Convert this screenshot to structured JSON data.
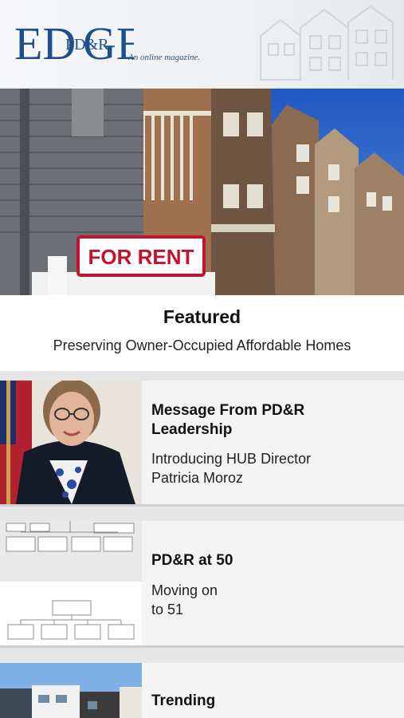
{
  "header": {
    "logo_letters_left": "ED",
    "logo_inner": "PD&R",
    "logo_letters_right": "GE",
    "tagline": "An online magazine."
  },
  "hero": {
    "sign_text": "FOR RENT"
  },
  "featured": {
    "title": "Featured",
    "subtitle": "Preserving Owner-Occupied Affordable Homes"
  },
  "cards": [
    {
      "title_line1": "Message From PD&R",
      "title_line2": "Leadership",
      "subtitle_line1": "Introducing HUB Director",
      "subtitle_line2": "Patricia Moroz"
    },
    {
      "title_line1": "PD&R at 50",
      "subtitle_line1": "Moving on",
      "subtitle_line2": "to 51"
    },
    {
      "title_line1": "Trending"
    }
  ],
  "colors": {
    "brand_blue": "#1f4e8c",
    "sign_red": "#c8102e",
    "sky": "#2f66c4"
  }
}
